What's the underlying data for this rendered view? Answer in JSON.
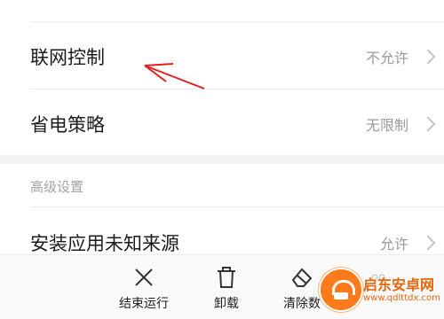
{
  "settings": {
    "network_control": {
      "title": "联网控制",
      "value": "不允许"
    },
    "power_strategy": {
      "title": "省电策略",
      "value": "无限制"
    },
    "advanced_section_title": "高级设置",
    "install_unknown": {
      "title": "安装应用未知来源",
      "value": "允许"
    }
  },
  "bottom_actions": {
    "stop": "结束运行",
    "uninstall": "卸载",
    "clear_data": "清除数"
  },
  "watermark": {
    "name": "启东安卓网",
    "url": "www.qdlttdx.com"
  },
  "colors": {
    "annotation_arrow": "#e02020",
    "watermark_accent": "#ff7a1a"
  }
}
